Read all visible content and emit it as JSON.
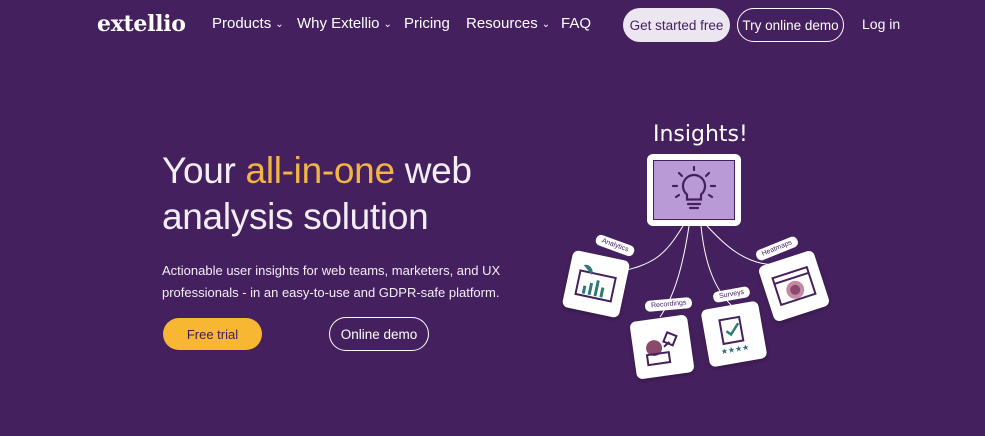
{
  "nav": {
    "logo": "extellio",
    "items": [
      {
        "label": "Products",
        "has_dropdown": true
      },
      {
        "label": "Why Extellio",
        "has_dropdown": true
      },
      {
        "label": "Pricing",
        "has_dropdown": false
      },
      {
        "label": "Resources",
        "has_dropdown": true
      },
      {
        "label": "FAQ",
        "has_dropdown": false
      }
    ],
    "get_started": "Get started free",
    "try_demo": "Try online demo",
    "login": "Log in"
  },
  "hero": {
    "title_pre": "Your ",
    "title_accent": "all-in-one",
    "title_post": " web analysis solution",
    "subtitle": "Actionable user insights for web teams, marketers, and UX professionals - in an easy-to-use and GDPR-safe platform.",
    "primary_cta": "Free trial",
    "secondary_cta": "Online demo"
  },
  "illustration": {
    "headline": "Insights!",
    "tiles": [
      "Analytics",
      "Recordings",
      "Surveys",
      "Heatmaps"
    ]
  },
  "colors": {
    "background": "#45205e",
    "accent": "#f2b544",
    "cta_yellow": "#f7b733",
    "bulb_fill": "#b99ad7"
  }
}
